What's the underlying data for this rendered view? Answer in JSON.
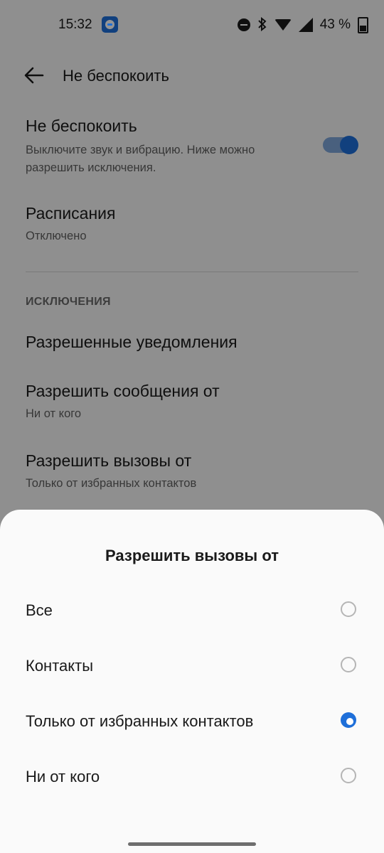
{
  "status_bar": {
    "time": "15:32",
    "battery_text": "43 %",
    "icons": [
      "dnd-badge-icon",
      "dnd-minus-icon",
      "bluetooth-icon",
      "wifi-icon",
      "signal-icon",
      "battery-icon"
    ]
  },
  "app_bar": {
    "title": "Не беспокоить"
  },
  "settings": {
    "dnd": {
      "title": "Не беспокоить",
      "subtitle_line1": "Выключите звук и вибрацию. Ниже можно",
      "subtitle_line2": "разрешить исключения.",
      "toggle_on": true
    },
    "schedule": {
      "title": "Расписания",
      "subtitle": "Отключено"
    },
    "exceptions_header": "ИСКЛЮЧЕНИЯ",
    "allowed_notifications": {
      "title": "Разрешенные уведомления"
    },
    "messages_from": {
      "title": "Разрешить сообщения от",
      "subtitle": "Ни от кого"
    },
    "calls_from": {
      "title": "Разрешить вызовы от",
      "subtitle": "Только от избранных контактов"
    }
  },
  "sheet": {
    "title": "Разрешить вызовы от",
    "options": [
      {
        "label": "Все",
        "selected": false
      },
      {
        "label": "Контакты",
        "selected": false
      },
      {
        "label": "Только от избранных контактов",
        "selected": true
      },
      {
        "label": "Ни от кого",
        "selected": false
      }
    ]
  },
  "colors": {
    "accent": "#1e6fd9",
    "scrim": "rgba(0,0,0,0.42)"
  }
}
